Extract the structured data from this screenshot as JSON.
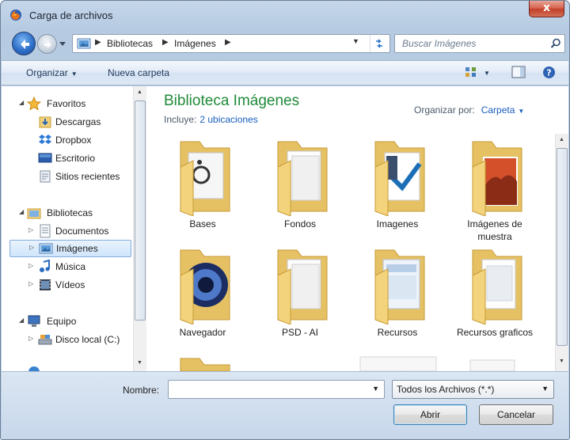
{
  "window": {
    "title": "Carga de archivos",
    "close_label": "x"
  },
  "address": {
    "crumbs": [
      "Bibliotecas",
      "Imágenes"
    ]
  },
  "search": {
    "placeholder": "Buscar Imágenes"
  },
  "toolbar": {
    "organize_label": "Organizar",
    "new_folder_label": "Nueva carpeta"
  },
  "nav_tree": {
    "favorites": {
      "label": "Favoritos",
      "items": [
        "Descargas",
        "Dropbox",
        "Escritorio",
        "Sitios recientes"
      ]
    },
    "libraries": {
      "label": "Bibliotecas",
      "items": [
        "Documentos",
        "Imágenes",
        "Música",
        "Vídeos"
      ],
      "selected": "Imágenes"
    },
    "computer": {
      "label": "Equipo",
      "items": [
        "Disco local (C:)"
      ]
    }
  },
  "library": {
    "title": "Biblioteca Imágenes",
    "includes_label": "Incluye:",
    "includes_link": "2 ubicaciones",
    "arrange_label": "Organizar por:",
    "arrange_value": "Carpeta"
  },
  "folders": [
    {
      "label": "Bases",
      "icon": "folder-wheelchair-icon"
    },
    {
      "label": "Fondos",
      "icon": "folder-documents-icon"
    },
    {
      "label": "Imagenes",
      "icon": "folder-checkmark-icon"
    },
    {
      "label": "Imágenes de muestra",
      "icon": "folder-photo-icon"
    },
    {
      "label": "Navegador",
      "icon": "folder-app-icon"
    },
    {
      "label": "PSD - AI",
      "icon": "folder-documents-icon"
    },
    {
      "label": "Recursos",
      "icon": "folder-screenshots-icon"
    },
    {
      "label": "Recursos graficos",
      "icon": "folder-documents-icon"
    }
  ],
  "footer": {
    "name_label": "Nombre:",
    "name_value": "",
    "filter_value": "Todos los Archivos (*.*)",
    "open_label": "Abrir",
    "cancel_label": "Cancelar"
  },
  "colors": {
    "library_title": "#1f8a38",
    "link": "#1a5ebe",
    "close": "#c1402a",
    "folder": "#f3d47c"
  }
}
